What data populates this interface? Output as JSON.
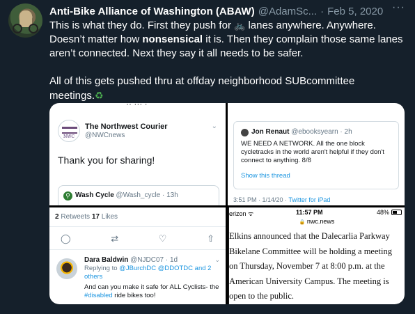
{
  "tweet": {
    "display_name": "Anti-Bike Alliance of Washington (ABAW)",
    "handle": "@AdamSc...",
    "separator": "·",
    "date": "Feb 5, 2020",
    "more": "···",
    "line1_a": "This is what they do. First they push for ",
    "bike_icon": "bike-icon",
    "line1_b": " lanes anywhere. Anywhere. Doesn’t matter how ",
    "bold_word": "nonsensical",
    "line1_c": " it is. Then they complain those same lanes aren’t connected. Next they say it all needs to be safer.",
    "line2": "All of this gets pushed thru at offday neighborhood SUBcommittee meetings.",
    "recycle_icon": "recycle-icon"
  },
  "panel1": {
    "cut_text": "·· ··· ·",
    "account_name": "The Northwest Courier",
    "account_handle": "@NWCnews",
    "logo_text": "NWC",
    "chevron": "⌄",
    "reply_text": "Thank you for sharing!",
    "quoted_name": "Wash Cycle",
    "quoted_meta": " @Wash_cycle · 13h"
  },
  "panel2": {
    "name": "Jon Renaut",
    "meta": " @ebooksyearn · 2h",
    "text": "WE NEED A NETWORK. All the one block cycletracks in the world aren't helpful if they don't connect to anything.  8/8",
    "link": "Show this thread",
    "timestamp": "3:51 PM · 1/14/20 · ",
    "source": "Twitter for iPad"
  },
  "panel3": {
    "retweets_count": "2",
    "retweets_label": " Retweets  ",
    "likes_count": "17",
    "likes_label": " Likes",
    "actions": [
      "◯",
      "⇄",
      "♡",
      "⇧"
    ],
    "reply_name": "Dara Baldwin",
    "reply_meta": " @NJDC07 · 1d",
    "replying_prefix": "Replying to ",
    "replying_to": "@JBurchDC @DDOTDC and 2 others",
    "reply_text_a": "And can you make it safe for ALL Cyclists- the ",
    "hashtag": "#disabled",
    "reply_text_b": " ride bikes too!"
  },
  "panel4": {
    "carrier": "erizon ᯤ",
    "time": "11:57 PM",
    "battery": "48%",
    "lock": "🔒",
    "url": " nwc.news",
    "article_lines": [
      "Elkins announced that the Dalecarlia Parkway",
      "Bikelane Committee will be holding a meeting",
      "on Thursday, November 7 at 8:00 p.m. at the",
      "American University Campus. The meeting is",
      "open to the public."
    ]
  }
}
